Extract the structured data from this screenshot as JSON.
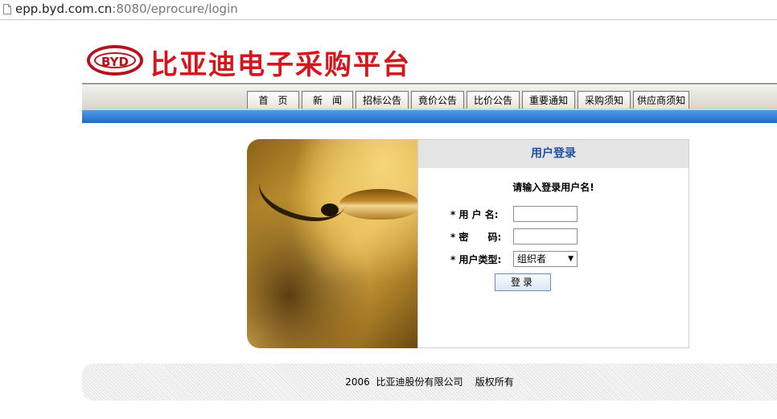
{
  "browser": {
    "url_host": "epp.byd.com.cn",
    "url_rest": ":8080/eprocure/login",
    "icon": "document-icon"
  },
  "header": {
    "logo_text": "BYD",
    "title": "比亚迪电子采购平台"
  },
  "nav": {
    "tabs": [
      {
        "label": "首　页"
      },
      {
        "label": "新　闻"
      },
      {
        "label": "招标公告"
      },
      {
        "label": "竟价公告"
      },
      {
        "label": "比价公告"
      },
      {
        "label": "重要通知"
      },
      {
        "label": "采购须知"
      },
      {
        "label": "供应商须知"
      }
    ]
  },
  "login": {
    "title": "用户登录",
    "prompt": "请输入登录用户名!",
    "username_label": "* 用 户 名:",
    "username_value": "",
    "password_label": "* 密　　码:",
    "password_value": "",
    "usertype_label": "* 用户类型:",
    "usertype_selected": "组织者",
    "submit_label": "登录"
  },
  "footer": {
    "text": "2006  比亚迪股份有限公司    版权所有"
  },
  "colors": {
    "brand_red": "#d4161d",
    "nav_blue": "#1f6cc9",
    "panel_title": "#1f4f9b"
  }
}
